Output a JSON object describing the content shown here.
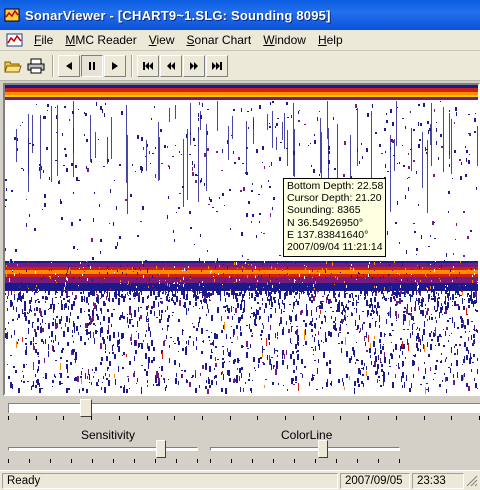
{
  "window": {
    "title": "SonarViewer - [CHART9~1.SLG: Sounding 8095]"
  },
  "menu": {
    "items": [
      {
        "pre": "",
        "ul": "F",
        "post": "ile"
      },
      {
        "pre": "",
        "ul": "M",
        "post": "MC Reader"
      },
      {
        "pre": "",
        "ul": "V",
        "post": "iew"
      },
      {
        "pre": "",
        "ul": "S",
        "post": "onar Chart"
      },
      {
        "pre": "",
        "ul": "W",
        "post": "indow"
      },
      {
        "pre": "",
        "ul": "H",
        "post": "elp"
      }
    ]
  },
  "toolbar": {
    "buttons": [
      "open-folder-icon",
      "printer-icon",
      "play-back-icon",
      "pause-icon",
      "play-forward-icon",
      "skip-start-icon",
      "rewind-icon",
      "fast-forward-icon",
      "skip-end-icon"
    ],
    "pressed": "pause-icon"
  },
  "tooltip": {
    "bottom_depth": "Bottom Depth: 22.58",
    "cursor_depth": "Cursor Depth: 21.20",
    "sounding": "Sounding: 8365",
    "latitude": "N 36.54926950°",
    "longitude": "E 137.83841640°",
    "datetime": "2007/09/04 11:21:14"
  },
  "position_scroll": {
    "position": 0.15
  },
  "sliders": {
    "sensitivity": {
      "label": "Sensitivity",
      "value": 0.82
    },
    "colorline": {
      "label": "ColorLine",
      "value": 0.6
    }
  },
  "status": {
    "ready": "Ready",
    "date": "2007/09/05",
    "time": "23:33"
  },
  "colors": {
    "titlebar": "#0a52d8",
    "echo_strong": "#ff8c00",
    "echo_core": "#d02010",
    "echo_medium": "#7a1a7a",
    "echo_weak": "#1a1a8c",
    "tooltip_bg": "#ffffe1"
  }
}
